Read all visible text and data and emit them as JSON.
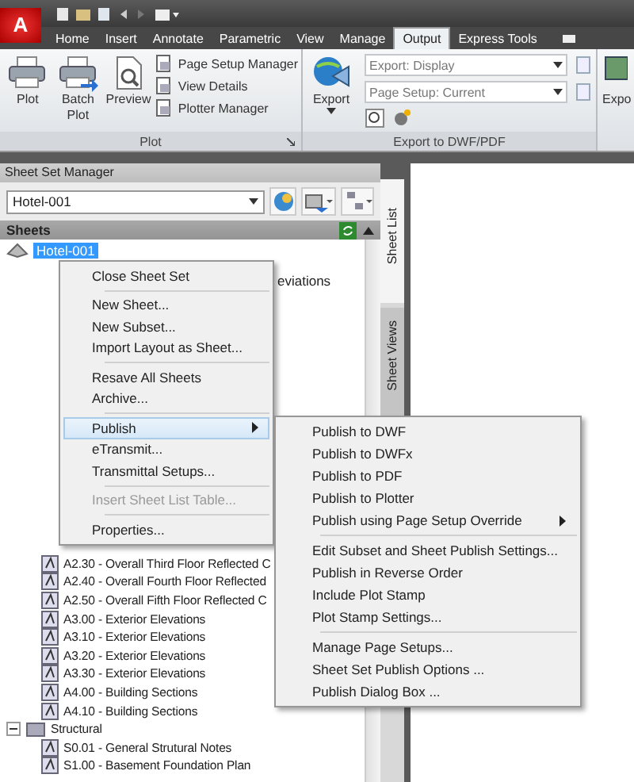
{
  "quick_access": {
    "app_button": "A"
  },
  "ribbon_tabs": [
    {
      "label": "Home",
      "selected": false
    },
    {
      "label": "Insert",
      "selected": false
    },
    {
      "label": "Annotate",
      "selected": false
    },
    {
      "label": "Parametric",
      "selected": false
    },
    {
      "label": "View",
      "selected": false
    },
    {
      "label": "Manage",
      "selected": false
    },
    {
      "label": "Output",
      "selected": true
    },
    {
      "label": "Express Tools",
      "selected": false
    }
  ],
  "plot_panel": {
    "title": "Plot",
    "large_buttons": [
      {
        "label": "Plot",
        "kind": "printer"
      },
      {
        "label": "Batch Plot",
        "kind": "batch"
      },
      {
        "label": "Preview",
        "kind": "preview"
      }
    ],
    "small_buttons": [
      "Page Setup Manager",
      "View Details",
      "Plotter Manager"
    ]
  },
  "export_panel": {
    "title": "Export to DWF/PDF",
    "export_button": "Export",
    "dropdowns": [
      "Export: Display",
      "Page Setup: Current"
    ]
  },
  "next_panel": {
    "button_label": "Expo"
  },
  "sheet_set_manager": {
    "title": "Sheet Set Manager",
    "set_dropdown": "Hotel-001",
    "sheets_header": "Sheets",
    "side_tabs": [
      {
        "label": "Sheet List",
        "selected": true
      },
      {
        "label": "Sheet Views",
        "selected": false
      }
    ],
    "root": {
      "label": "Hotel-001",
      "selected": true
    },
    "covered_fragment": "eviations",
    "tree": [
      {
        "label": "A2.30 - Overall Third Floor Reflected C",
        "kind": "sheet"
      },
      {
        "label": "A2.40 - Overall Fourth Floor Reflected",
        "kind": "sheet"
      },
      {
        "label": "A2.50 - Overall Fifth Floor Reflected C",
        "kind": "sheet"
      },
      {
        "label": "A3.00 - Exterior Elevations",
        "kind": "sheet"
      },
      {
        "label": "A3.10 - Exterior Elevations",
        "kind": "sheet"
      },
      {
        "label": "A3.20 - Exterior Elevations",
        "kind": "sheet"
      },
      {
        "label": "A3.30 - Exterior Elevations",
        "kind": "sheet"
      },
      {
        "label": "A4.00 - Building Sections",
        "kind": "sheet"
      },
      {
        "label": "A4.10 - Building Sections",
        "kind": "sheet"
      }
    ],
    "subsets": [
      {
        "label": "Structural",
        "expanded": true,
        "children": [
          {
            "label": "S0.01 - General Strutural Notes",
            "kind": "sheet"
          },
          {
            "label": "S1.00 - Basement Foundation Plan",
            "kind": "sheet"
          }
        ]
      }
    ]
  },
  "context_menu": [
    [
      {
        "label": "Close Sheet Set",
        "disabled": false,
        "selected": false,
        "submenu": false
      }
    ],
    [
      {
        "label": "New Sheet...",
        "disabled": false,
        "selected": false,
        "submenu": false
      },
      {
        "label": "New Subset...",
        "disabled": false,
        "selected": false,
        "submenu": false
      },
      {
        "label": "Import Layout as Sheet...",
        "disabled": false,
        "selected": false,
        "submenu": false
      }
    ],
    [
      {
        "label": "Resave All Sheets",
        "disabled": false,
        "selected": false,
        "submenu": false
      },
      {
        "label": "Archive...",
        "disabled": false,
        "selected": false,
        "submenu": false
      }
    ],
    [
      {
        "label": "Publish",
        "disabled": false,
        "selected": true,
        "submenu": true
      },
      {
        "label": "eTransmit...",
        "disabled": false,
        "selected": false,
        "submenu": false
      },
      {
        "label": "Transmittal Setups...",
        "disabled": false,
        "selected": false,
        "submenu": false
      }
    ],
    [
      {
        "label": "Insert Sheet List Table...",
        "disabled": true,
        "selected": false,
        "submenu": false
      }
    ],
    [
      {
        "label": "Properties...",
        "disabled": false,
        "selected": false,
        "submenu": false
      }
    ]
  ],
  "publish_submenu": [
    [
      {
        "label": "Publish to DWF",
        "submenu": false
      },
      {
        "label": "Publish to DWFx",
        "submenu": false
      },
      {
        "label": "Publish to PDF",
        "submenu": false
      },
      {
        "label": "Publish to Plotter",
        "submenu": false
      },
      {
        "label": "Publish using Page Setup Override",
        "submenu": true
      }
    ],
    [
      {
        "label": "Edit Subset and Sheet Publish Settings...",
        "submenu": false
      },
      {
        "label": "Publish in Reverse Order",
        "submenu": false
      },
      {
        "label": "Include Plot Stamp",
        "submenu": false
      },
      {
        "label": "Plot Stamp Settings...",
        "submenu": false
      }
    ],
    [
      {
        "label": "Manage Page Setups...",
        "submenu": false
      },
      {
        "label": "Sheet Set Publish Options ...",
        "submenu": false
      },
      {
        "label": "Publish Dialog Box ...",
        "submenu": false
      }
    ]
  ]
}
